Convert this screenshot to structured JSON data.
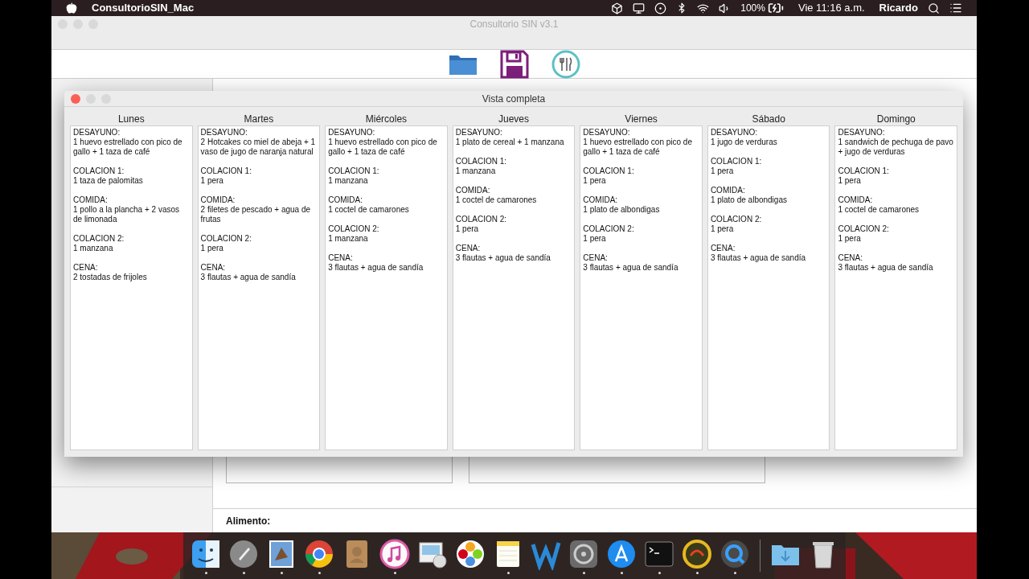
{
  "menubar": {
    "app_name": "ConsultorioSIN_Mac",
    "battery": "100%",
    "clock": "Vie 11:16 a.m.",
    "user": "Ricardo"
  },
  "window": {
    "title": "Consultorio SIN v3.1"
  },
  "dialog": {
    "title": "Vista completa",
    "days": [
      {
        "name": "Lunes",
        "meals": [
          {
            "label": "DESAYUNO:",
            "food": "1 huevo estrellado con pico de gallo + 1 taza de café"
          },
          {
            "label": "COLACION 1:",
            "food": "1 taza de palomitas"
          },
          {
            "label": "COMIDA:",
            "food": "1 pollo a la plancha + 2 vasos de limonada"
          },
          {
            "label": "COLACION 2:",
            "food": "1 manzana"
          },
          {
            "label": "CENA:",
            "food": "2 tostadas de frijoles"
          }
        ]
      },
      {
        "name": "Martes",
        "meals": [
          {
            "label": "DESAYUNO:",
            "food": "2 Hotcakes co miel de abeja + 1 vaso de jugo de naranja natural"
          },
          {
            "label": "COLACION 1:",
            "food": "1 pera"
          },
          {
            "label": "COMIDA:",
            "food": "2 filetes de pescado + agua de frutas"
          },
          {
            "label": "COLACION 2:",
            "food": "1 pera"
          },
          {
            "label": "CENA:",
            "food": "3 flautas + agua de sandía"
          }
        ]
      },
      {
        "name": "Miércoles",
        "meals": [
          {
            "label": "DESAYUNO:",
            "food": "1 huevo estrellado con pico de gallo + 1 taza de café"
          },
          {
            "label": "COLACION 1:",
            "food": "1 manzana"
          },
          {
            "label": "COMIDA:",
            "food": "1 coctel de camarones"
          },
          {
            "label": "COLACION 2:",
            "food": "1 manzana"
          },
          {
            "label": "CENA:",
            "food": "3 flautas + agua de sandía"
          }
        ]
      },
      {
        "name": "Jueves",
        "meals": [
          {
            "label": "DESAYUNO:",
            "food": "1 plato de cereal + 1 manzana"
          },
          {
            "label": "COLACION 1:",
            "food": "1 manzana"
          },
          {
            "label": "COMIDA:",
            "food": "1 coctel de camarones"
          },
          {
            "label": "COLACION 2:",
            "food": "1 pera"
          },
          {
            "label": "CENA:",
            "food": "3 flautas + agua de sandía"
          }
        ]
      },
      {
        "name": "Viernes",
        "meals": [
          {
            "label": "DESAYUNO:",
            "food": "1 huevo estrellado con pico de gallo + 1 taza de café"
          },
          {
            "label": "COLACION 1:",
            "food": "1 pera"
          },
          {
            "label": "COMIDA:",
            "food": "1 plato de albondigas"
          },
          {
            "label": "COLACION 2:",
            "food": "1 pera"
          },
          {
            "label": "CENA:",
            "food": "3 flautas + agua de sandía"
          }
        ]
      },
      {
        "name": "Sábado",
        "meals": [
          {
            "label": "DESAYUNO:",
            "food": "1 jugo de verduras"
          },
          {
            "label": "COLACION 1:",
            "food": "1 pera"
          },
          {
            "label": "COMIDA:",
            "food": "1 plato de albondigas"
          },
          {
            "label": "COLACION 2:",
            "food": "1 pera"
          },
          {
            "label": "CENA:",
            "food": "3 flautas + agua de sandía"
          }
        ]
      },
      {
        "name": "Domingo",
        "meals": [
          {
            "label": "DESAYUNO:",
            "food": "1 sandwich de pechuga de pavo + jugo de verduras"
          },
          {
            "label": "COLACION 1:",
            "food": "1 pera"
          },
          {
            "label": "COMIDA:",
            "food": "1 coctel de camarones"
          },
          {
            "label": "COLACION 2:",
            "food": "1 pera"
          },
          {
            "label": "CENA:",
            "food": "3 flautas + agua de sandía"
          }
        ]
      }
    ]
  },
  "bottom_bar": {
    "label": "Alimento:"
  }
}
